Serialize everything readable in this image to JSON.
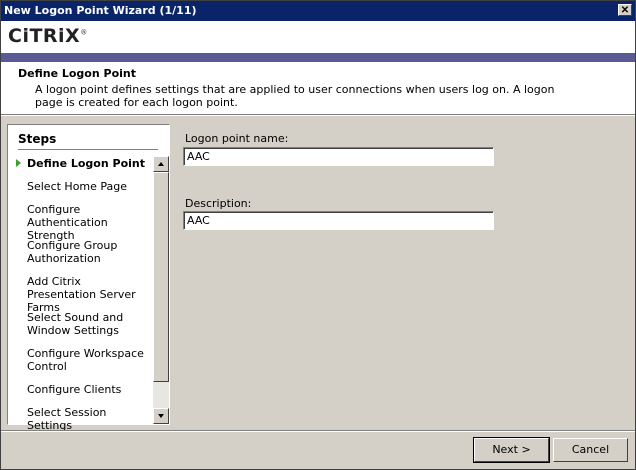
{
  "window": {
    "title": "New Logon Point Wizard (1/11)",
    "close_glyph": "✕"
  },
  "header": {
    "logo_text": "CiTRiX",
    "logo_mark": "®",
    "section_title": "Define Logon Point",
    "section_description": "A logon point defines settings that are applied to user connections when users log on. A logon page is created for each logon point."
  },
  "steps": {
    "heading": "Steps",
    "items": [
      {
        "label": "Define Logon Point",
        "active": true
      },
      {
        "label": "Select Home Page",
        "active": false
      },
      {
        "label": "Configure Authentication Strength",
        "active": false
      },
      {
        "label": "Configure Group Authorization",
        "active": false
      },
      {
        "label": "Add Citrix Presentation Server Farms",
        "active": false
      },
      {
        "label": "Select Sound and Window Settings",
        "active": false
      },
      {
        "label": "Configure Workspace Control",
        "active": false
      },
      {
        "label": "Configure Clients",
        "active": false
      },
      {
        "label": "Select Session Settings",
        "active": false
      }
    ]
  },
  "form": {
    "logon_point_name_label": "Logon point name:",
    "logon_point_name_value": "AAC",
    "description_label": "Description:",
    "description_value": "AAC"
  },
  "buttons": {
    "next": "Next >",
    "cancel": "Cancel"
  },
  "colors": {
    "titlebar": "#0a246a",
    "accent_bar": "#5a5b94",
    "active_arrow": "#3aa12f"
  }
}
